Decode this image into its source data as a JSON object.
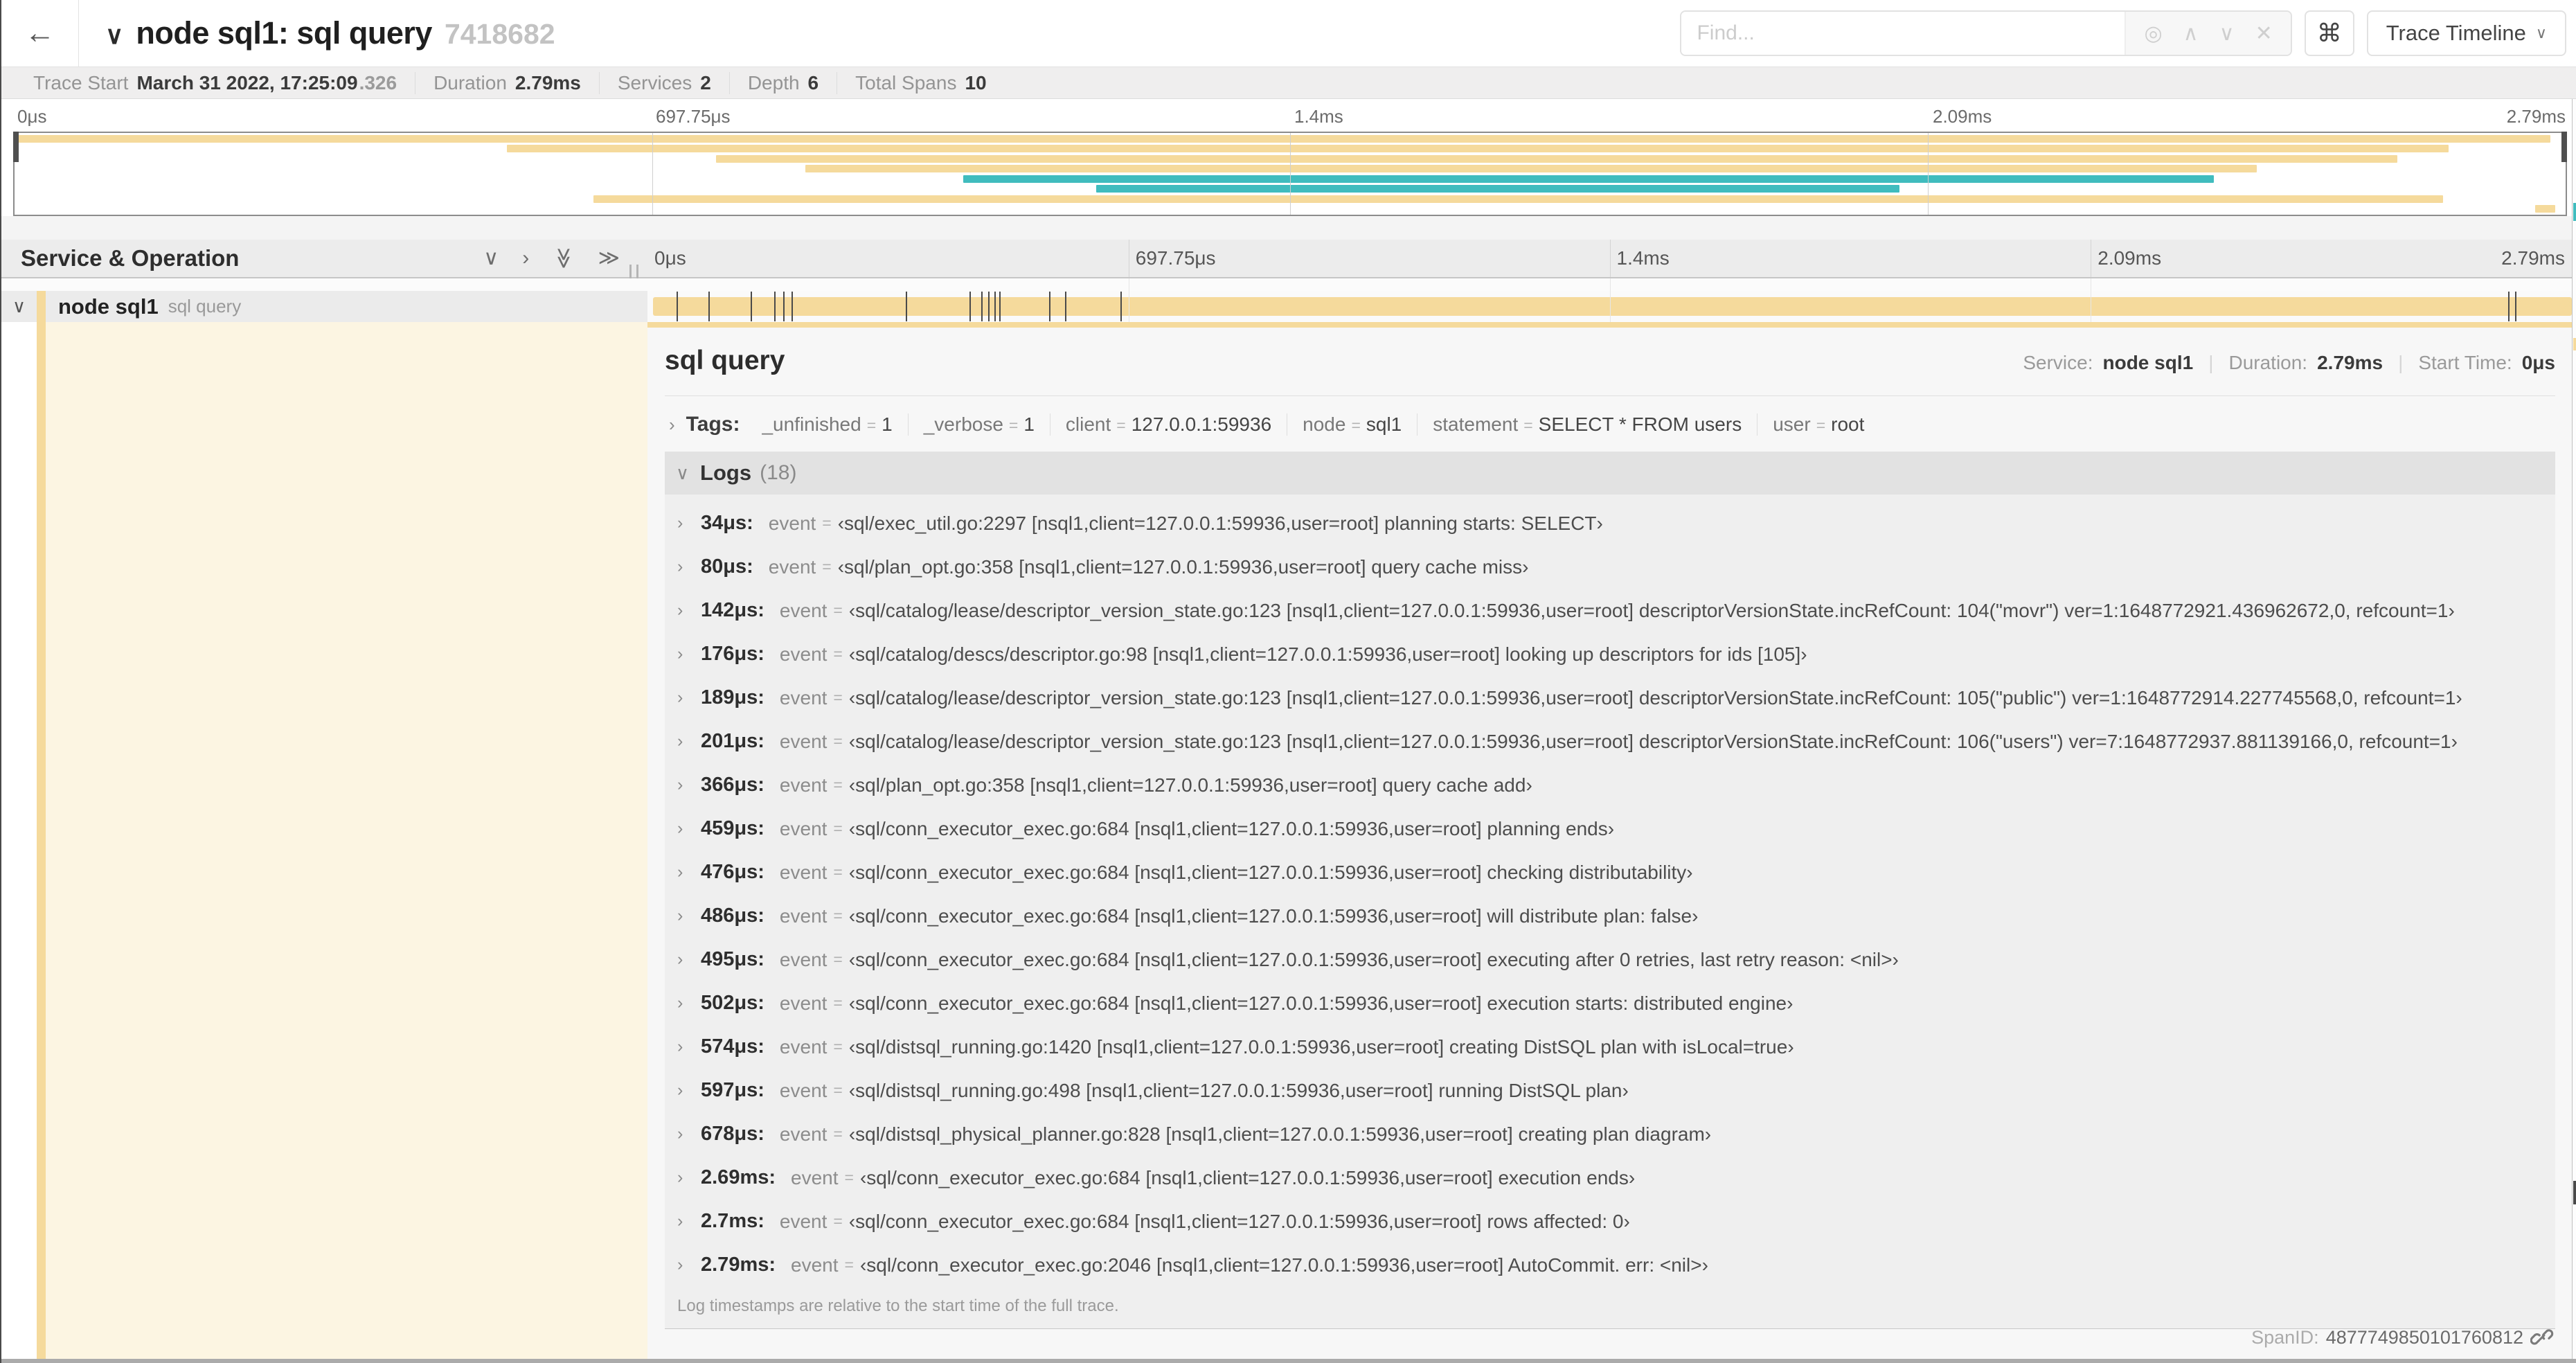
{
  "header": {
    "back_icon": "←",
    "collapse_icon": "∨",
    "title": "node sql1: sql query",
    "trace_id": "7418682",
    "find_placeholder": "Find...",
    "find_icons": [
      "◎",
      "∧",
      "∨",
      "✕"
    ],
    "shortcut_button": "⌘",
    "view_button": "Trace Timeline",
    "view_button_caret": "∨"
  },
  "summary": {
    "items": [
      {
        "label": "Trace Start",
        "value": "March 31 2022, 17:25:09",
        "suffix": ".326"
      },
      {
        "label": "Duration",
        "value": "2.79ms",
        "suffix": ""
      },
      {
        "label": "Services",
        "value": "2",
        "suffix": ""
      },
      {
        "label": "Depth",
        "value": "6",
        "suffix": ""
      },
      {
        "label": "Total Spans",
        "value": "10",
        "suffix": ""
      }
    ]
  },
  "ruler_labels": [
    "0μs",
    "697.75μs",
    "1.4ms",
    "2.09ms",
    "2.79ms"
  ],
  "minimap": {
    "rows": [
      {
        "s": 0,
        "e": 99.4,
        "c": "tan"
      },
      {
        "s": 19.3,
        "e": 95.4,
        "c": "tan"
      },
      {
        "s": 27.5,
        "e": 93.4,
        "c": "tan"
      },
      {
        "s": 31.0,
        "e": 87.9,
        "c": "tan"
      },
      {
        "s": 37.2,
        "e": 86.2,
        "c": "teal"
      },
      {
        "s": 42.4,
        "e": 73.9,
        "c": "teal"
      },
      {
        "s": 22.7,
        "e": 95.2,
        "c": "tan"
      },
      {
        "s": 98.8,
        "e": 99.6,
        "c": "tan"
      }
    ]
  },
  "timeline": {
    "header_title": "Service & Operation",
    "total_us": 2790
  },
  "row": {
    "chevron": "∨",
    "service": "node sql1",
    "operation": "sql query"
  },
  "detail": {
    "title": "sql query",
    "service_label": "Service:",
    "service": "node sql1",
    "duration_label": "Duration:",
    "duration": "2.79ms",
    "start_label": "Start Time:",
    "start": "0μs"
  },
  "tags": {
    "toggle_icon": "›",
    "label": "Tags:",
    "items": [
      {
        "key": "_unfinished",
        "value": "1"
      },
      {
        "key": "_verbose",
        "value": "1"
      },
      {
        "key": "client",
        "value": "127.0.0.1:59936"
      },
      {
        "key": "node",
        "value": "sql1"
      },
      {
        "key": "statement",
        "value": "SELECT * FROM users"
      },
      {
        "key": "user",
        "value": "root"
      }
    ]
  },
  "logs": {
    "toggle_icon": "∨",
    "label": "Logs",
    "count": "(18)",
    "key": "event",
    "note": "Log timestamps are relative to the start time of the full trace.",
    "entries": [
      {
        "time": "34μs:",
        "t_us": 34,
        "value": "‹sql/exec_util.go:2297 [nsql1,client=127.0.0.1:59936,user=root] planning starts: SELECT›"
      },
      {
        "time": "80μs:",
        "t_us": 80,
        "value": "‹sql/plan_opt.go:358 [nsql1,client=127.0.0.1:59936,user=root] query cache miss›"
      },
      {
        "time": "142μs:",
        "t_us": 142,
        "value": "‹sql/catalog/lease/descriptor_version_state.go:123 [nsql1,client=127.0.0.1:59936,user=root] descriptorVersionState.incRefCount: 104(\"movr\") ver=1:1648772921.436962672,0, refcount=1›"
      },
      {
        "time": "176μs:",
        "t_us": 176,
        "value": "‹sql/catalog/descs/descriptor.go:98 [nsql1,client=127.0.0.1:59936,user=root] looking up descriptors for ids [105]›"
      },
      {
        "time": "189μs:",
        "t_us": 189,
        "value": "‹sql/catalog/lease/descriptor_version_state.go:123 [nsql1,client=127.0.0.1:59936,user=root] descriptorVersionState.incRefCount: 105(\"public\") ver=1:1648772914.227745568,0, refcount=1›"
      },
      {
        "time": "201μs:",
        "t_us": 201,
        "value": "‹sql/catalog/lease/descriptor_version_state.go:123 [nsql1,client=127.0.0.1:59936,user=root] descriptorVersionState.incRefCount: 106(\"users\") ver=7:1648772937.881139166,0, refcount=1›"
      },
      {
        "time": "366μs:",
        "t_us": 366,
        "value": "‹sql/plan_opt.go:358 [nsql1,client=127.0.0.1:59936,user=root] query cache add›"
      },
      {
        "time": "459μs:",
        "t_us": 459,
        "value": "‹sql/conn_executor_exec.go:684 [nsql1,client=127.0.0.1:59936,user=root] planning ends›"
      },
      {
        "time": "476μs:",
        "t_us": 476,
        "value": "‹sql/conn_executor_exec.go:684 [nsql1,client=127.0.0.1:59936,user=root] checking distributability›"
      },
      {
        "time": "486μs:",
        "t_us": 486,
        "value": "‹sql/conn_executor_exec.go:684 [nsql1,client=127.0.0.1:59936,user=root] will distribute plan: false›"
      },
      {
        "time": "495μs:",
        "t_us": 495,
        "value": "‹sql/conn_executor_exec.go:684 [nsql1,client=127.0.0.1:59936,user=root] executing after 0 retries, last retry reason: <nil>›"
      },
      {
        "time": "502μs:",
        "t_us": 502,
        "value": "‹sql/conn_executor_exec.go:684 [nsql1,client=127.0.0.1:59936,user=root] execution starts: distributed engine›"
      },
      {
        "time": "574μs:",
        "t_us": 574,
        "value": "‹sql/distsql_running.go:1420 [nsql1,client=127.0.0.1:59936,user=root] creating DistSQL plan with isLocal=true›"
      },
      {
        "time": "597μs:",
        "t_us": 597,
        "value": "‹sql/distsql_running.go:498 [nsql1,client=127.0.0.1:59936,user=root] running DistSQL plan›"
      },
      {
        "time": "678μs:",
        "t_us": 678,
        "value": "‹sql/distsql_physical_planner.go:828 [nsql1,client=127.0.0.1:59936,user=root] creating plan diagram›"
      },
      {
        "time": "2.69ms:",
        "t_us": 2690,
        "value": "‹sql/conn_executor_exec.go:684 [nsql1,client=127.0.0.1:59936,user=root] execution ends›"
      },
      {
        "time": "2.7ms:",
        "t_us": 2700,
        "value": "‹sql/conn_executor_exec.go:684 [nsql1,client=127.0.0.1:59936,user=root] rows affected: 0›"
      },
      {
        "time": "2.79ms:",
        "t_us": 2790,
        "value": "‹sql/conn_executor_exec.go:2046 [nsql1,client=127.0.0.1:59936,user=root] AutoCommit. err: <nil>›"
      }
    ]
  },
  "footer": {
    "spanid_label": "SpanID:",
    "spanid": "4877749850101760812"
  },
  "colors": {
    "tan": "#F5DA9C",
    "teal": "#40BCBE"
  }
}
